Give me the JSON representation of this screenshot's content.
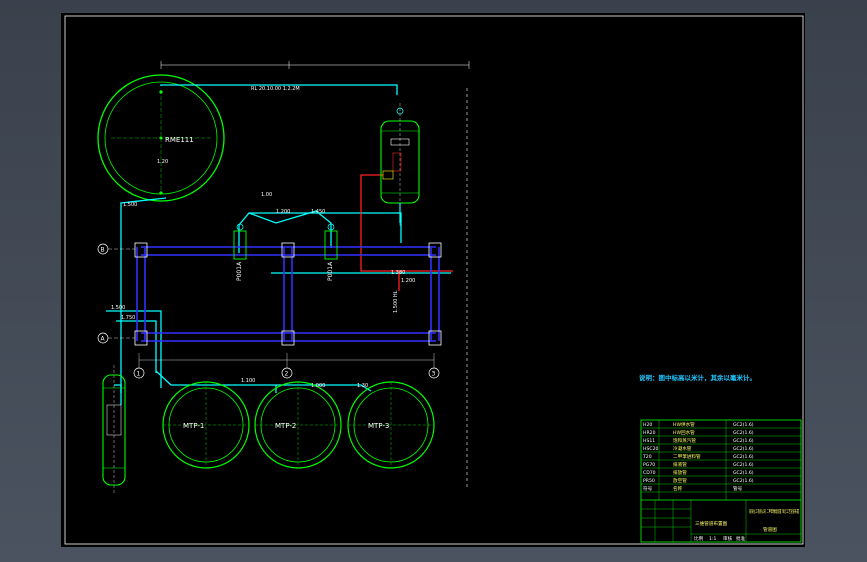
{
  "drawing": {
    "grid_rows": [
      "B",
      "A"
    ],
    "grid_cols": [
      "1",
      "2",
      "3"
    ],
    "tanks": [
      {
        "id": "main-tank",
        "label": "RME111"
      },
      {
        "id": "mtp1",
        "label": "MTP-1"
      },
      {
        "id": "mtp2",
        "label": "MTP-2"
      },
      {
        "id": "mtp3",
        "label": "MTP-3"
      }
    ],
    "pumps": [
      "P001A",
      "P001A"
    ],
    "dim_texts": {
      "top": "RL 20.10.00 1.2.2M",
      "a": "1.00",
      "b": "1.200",
      "c": "1.450",
      "d": "1.500",
      "e": "1.380",
      "f": "1.200",
      "g": "1.100",
      "h": "1.000",
      "i": "1.30",
      "j": "1.20",
      "k": "1.500",
      "l": "1.750",
      "m": "1.500 HL"
    },
    "note": "说明：图中标高以米计，其余以毫米计。"
  },
  "title_block": {
    "rows": [
      [
        "H20",
        "HW供水管",
        "GC2(1.6)"
      ],
      [
        "HR20",
        "HW回水管",
        "GC2(1.6)"
      ],
      [
        "HS11",
        "饱和蒸汽管",
        "GC2(1.6)"
      ],
      [
        "HSC20",
        "冷凝水管",
        "GC2(1.6)"
      ],
      [
        "T20",
        "二甲苯进料管",
        "GC2(1.6)"
      ],
      [
        "PG70",
        "排液管",
        "GC2(1.6)"
      ],
      [
        "CD70",
        "排放管",
        "GC2(1.6)"
      ],
      [
        "PR50",
        "放空管",
        "GC2(1.6)"
      ],
      [
        "符号",
        "名称",
        "管号"
      ]
    ],
    "project": "三维管道布置图",
    "company": "某某化工有限公司 二甲苯精馏装置 单元工艺管道布置",
    "sheet_label": "管道图",
    "footer": [
      "比例",
      "1:1",
      "审核",
      "批准"
    ]
  }
}
